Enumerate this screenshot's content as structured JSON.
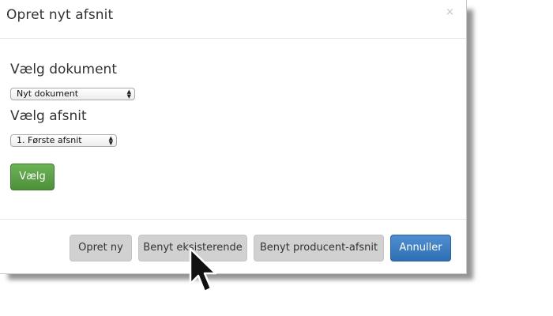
{
  "dialog": {
    "title": "Opret nyt afsnit",
    "close_label": "×"
  },
  "form": {
    "document_label": "Vælg dokument",
    "document_select_value": "Nyt dokument",
    "section_label": "Vælg afsnit",
    "section_select_value": "1. Første afsnit",
    "choose_button": "Vælg"
  },
  "footer": {
    "create_new": "Opret ny",
    "use_existing": "Benyt eksisterende",
    "use_producer": "Benyt producent-afsnit",
    "cancel": "Annuller"
  },
  "colors": {
    "primary_blue": "#337ab7",
    "success_green": "#5cb85c",
    "default_grey": "#d1d1d1"
  },
  "icons": [
    "close-icon",
    "select-arrows-icon",
    "mouse-pointer-icon"
  ]
}
